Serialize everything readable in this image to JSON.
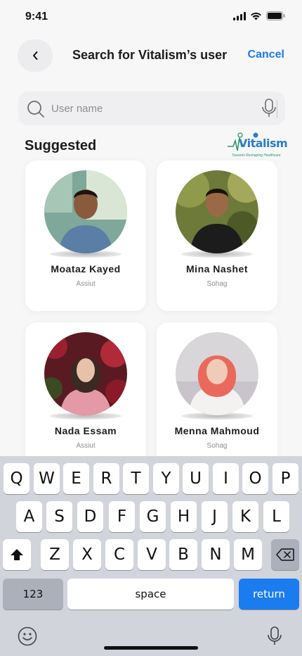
{
  "status": {
    "time": "9:41"
  },
  "header": {
    "title": "Search for Vitalism’s user",
    "cancel_label": "Cancel"
  },
  "search": {
    "placeholder": "User name",
    "value": ""
  },
  "section": {
    "title": "Suggested"
  },
  "logo": {
    "text": "Vitalism",
    "tagline": "Towards Reshaping Healthcare"
  },
  "users": [
    {
      "name": "Moataz Kayed",
      "city": "Assiut"
    },
    {
      "name": "Mina Nashet",
      "city": "Sohag"
    },
    {
      "name": "Nada Essam",
      "city": "Assiut"
    },
    {
      "name": "Menna Mahmoud",
      "city": "Sohag"
    }
  ],
  "keyboard": {
    "row1": [
      "Q",
      "W",
      "E",
      "R",
      "T",
      "Y",
      "U",
      "I",
      "O",
      "P"
    ],
    "row2": [
      "A",
      "S",
      "D",
      "F",
      "G",
      "H",
      "J",
      "K",
      "L"
    ],
    "row3": [
      "Z",
      "X",
      "C",
      "V",
      "B",
      "N",
      "M"
    ],
    "numbers_label": "123",
    "space_label": "space",
    "return_label": "return"
  },
  "colors": {
    "accent": "#1b7cf0",
    "keyboard_bg": "#d1d4db"
  }
}
